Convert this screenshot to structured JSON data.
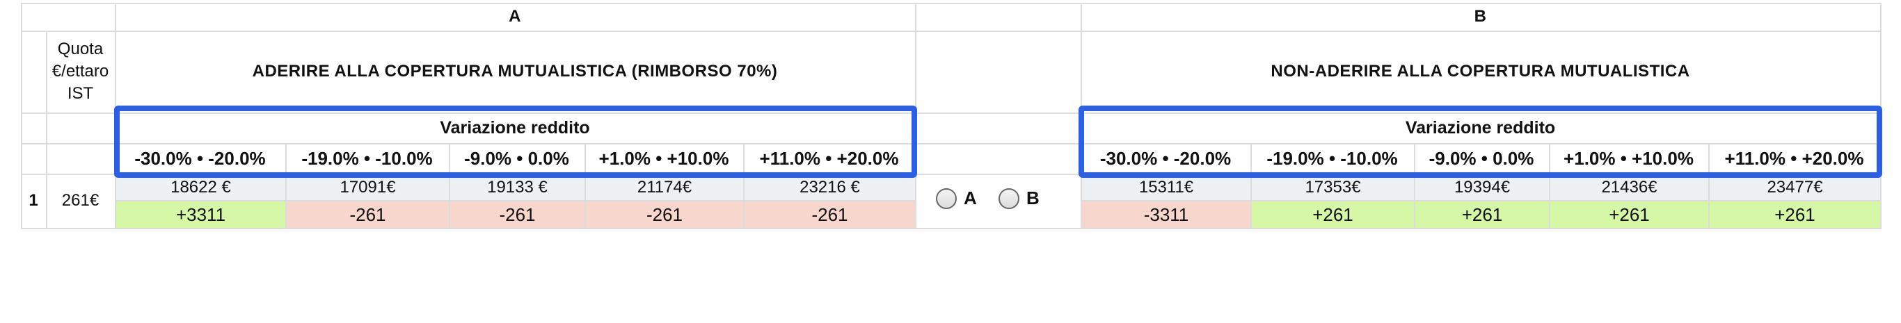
{
  "groups": {
    "a_label": "A",
    "b_label": "B"
  },
  "quota_header": [
    "Quota",
    "€/ettaro",
    "IST"
  ],
  "option_a": {
    "title": "ADERIRE ALLA COPERTURA MUTUALISTICA (RIMBORSO 70%)",
    "variation_header": "Variazione reddito",
    "ranges": [
      "-30.0% • -20.0%",
      "-19.0% • -10.0%",
      "-9.0% • 0.0%",
      "+1.0% • +10.0%",
      "+11.0% • +20.0%"
    ],
    "values": [
      "18622 €",
      "17091€",
      "19133 €",
      "21174€",
      "23216 €"
    ],
    "deltas": [
      "+3311",
      "-261",
      "-261",
      "-261",
      "-261"
    ],
    "delta_status": [
      "positive",
      "negative",
      "negative",
      "negative",
      "negative"
    ]
  },
  "option_b": {
    "title": "NON-ADERIRE ALLA COPERTURA MUTUALISTICA",
    "variation_header": "Variazione reddito",
    "ranges": [
      "-30.0% • -20.0%",
      "-19.0% • -10.0%",
      "-9.0% • 0.0%",
      "+1.0% • +10.0%",
      "+11.0% • +20.0%"
    ],
    "values": [
      "15311€",
      "17353€",
      "19394€",
      "21436€",
      "23477€"
    ],
    "deltas": [
      "-3311",
      "+261",
      "+261",
      "+261",
      "+261"
    ],
    "delta_status": [
      "negative",
      "positive",
      "positive",
      "positive",
      "positive"
    ]
  },
  "row": {
    "number": "1",
    "quota": "261€"
  },
  "choice": {
    "option_a": "A",
    "option_b": "B",
    "selected": null
  },
  "colors": {
    "highlight_box": "#2a5fe6",
    "positive_bg": "#d6f8a6",
    "negative_bg": "#f7d6cd",
    "value_bg": "#eef1f4"
  }
}
